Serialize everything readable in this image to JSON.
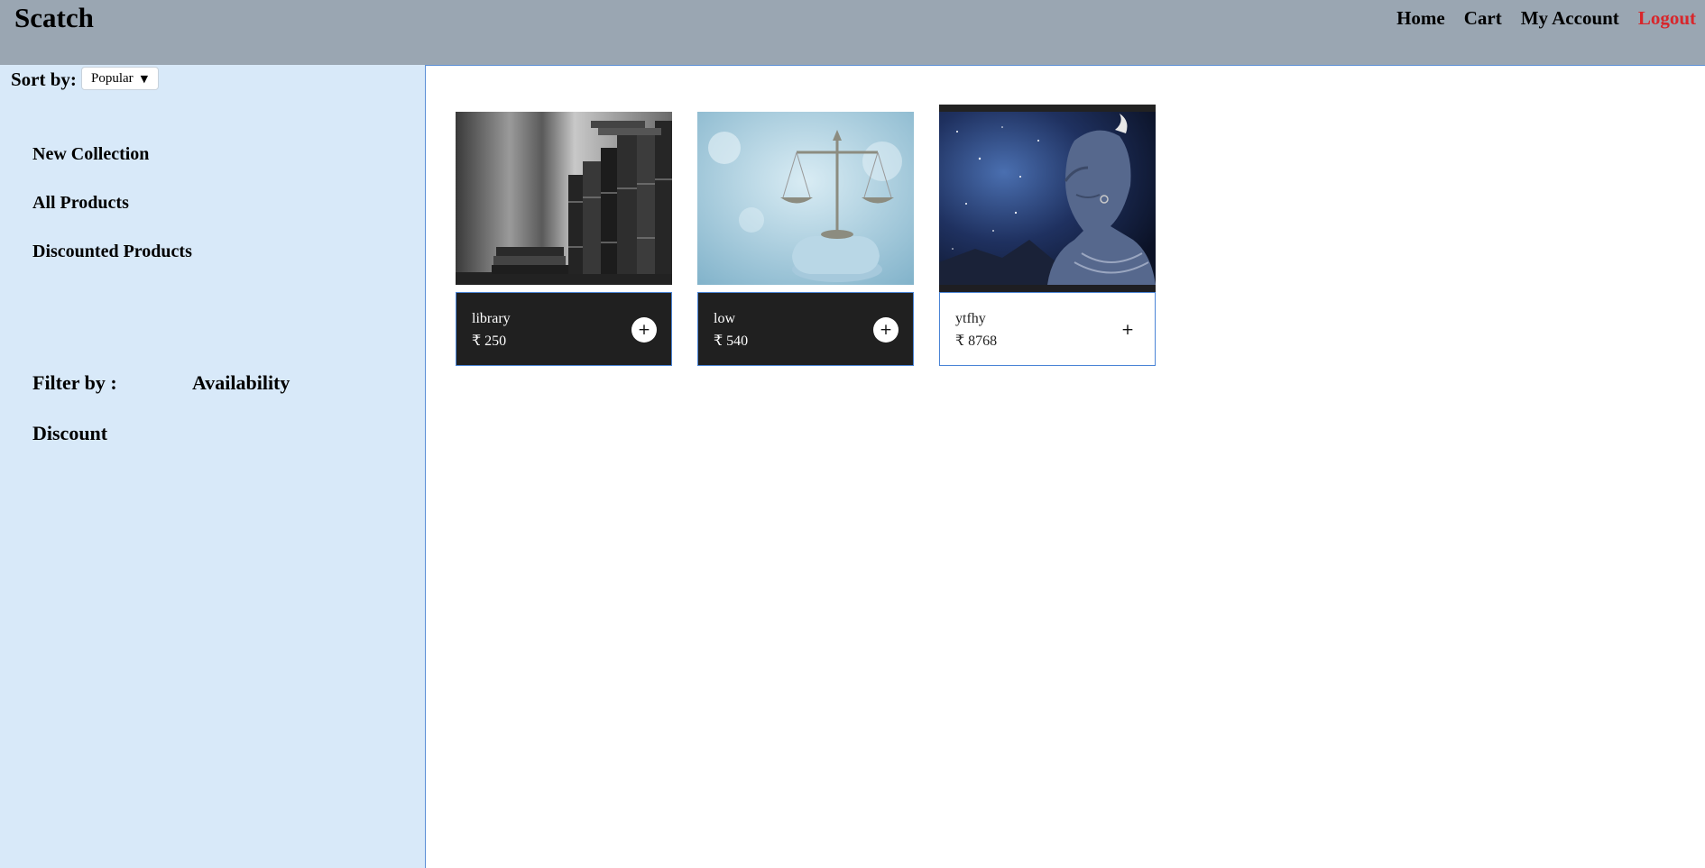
{
  "header": {
    "brand": "Scatch",
    "nav": {
      "home": "Home",
      "cart": "Cart",
      "account": "My Account",
      "logout": "Logout"
    }
  },
  "sidebar": {
    "sort_label": "Sort by:",
    "sort_value": "Popular",
    "links": {
      "new_collection": "New Collection",
      "all_products": "All Products",
      "discounted": "Discounted Products"
    },
    "filter_label": "Filter by :",
    "availability": "Availability",
    "discount": "Discount"
  },
  "products": [
    {
      "name": "library",
      "price": "₹ 250",
      "add": "+"
    },
    {
      "name": "low",
      "price": "₹ 540",
      "add": "+"
    },
    {
      "name": "ytfhy",
      "price": "₹ 8768",
      "add": "+"
    }
  ]
}
